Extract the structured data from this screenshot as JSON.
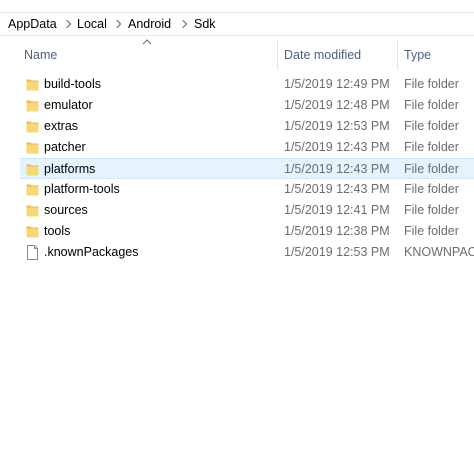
{
  "breadcrumb": [
    "AppData",
    "Local",
    "Android",
    "Sdk"
  ],
  "columns": {
    "name": "Name",
    "date": "Date modified",
    "type": "Type"
  },
  "files": [
    {
      "name": "build-tools",
      "date": "1/5/2019 12:49 PM",
      "type": "File folder",
      "icon": "folder-icon"
    },
    {
      "name": "emulator",
      "date": "1/5/2019 12:48 PM",
      "type": "File folder",
      "icon": "folder-icon"
    },
    {
      "name": "extras",
      "date": "1/5/2019 12:53 PM",
      "type": "File folder",
      "icon": "folder-icon"
    },
    {
      "name": "patcher",
      "date": "1/5/2019 12:43 PM",
      "type": "File folder",
      "icon": "folder-icon"
    },
    {
      "name": "platforms",
      "date": "1/5/2019 12:43 PM",
      "type": "File folder",
      "icon": "folder-icon"
    },
    {
      "name": "platform-tools",
      "date": "1/5/2019 12:43 PM",
      "type": "File folder",
      "icon": "folder-icon"
    },
    {
      "name": "sources",
      "date": "1/5/2019 12:41 PM",
      "type": "File folder",
      "icon": "folder-icon"
    },
    {
      "name": "tools",
      "date": "1/5/2019 12:38 PM",
      "type": "File folder",
      "icon": "folder-icon"
    },
    {
      "name": ".knownPackages",
      "date": "1/5/2019 12:53 PM",
      "type": "KNOWNPACKAGES File",
      "icon": "file-icon"
    }
  ],
  "colors": {
    "folder": "#f8d775",
    "selection": "#e5f3ff",
    "header_text": "#4d6082"
  }
}
